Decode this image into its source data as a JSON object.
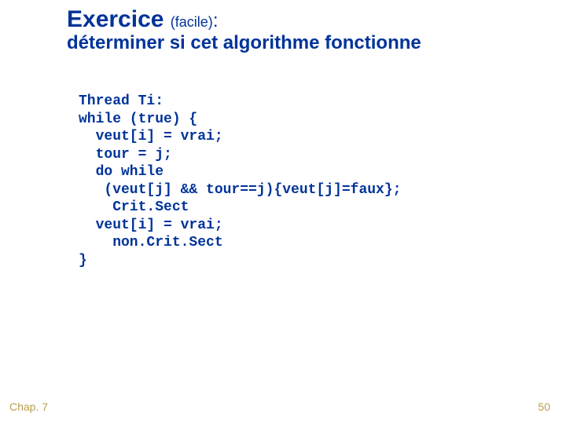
{
  "heading": {
    "title_main": "Exercice",
    "title_paren": "(facile)",
    "title_colon": ":",
    "subtitle": "déterminer si cet algorithme fonctionne"
  },
  "code": {
    "l1": "Thread Ti:",
    "l2": "while (true) {",
    "l3": "  veut[i] = vrai;",
    "l4": "  tour = j;",
    "l5": "  do while",
    "l6": "   (veut[j] && tour==j){veut[j]=faux};",
    "l7": "    Crit.Sect",
    "l8": "  veut[i] = vrai;",
    "l9": "    non.Crit.Sect",
    "l10": "}"
  },
  "footer": {
    "left": "Chap. 7",
    "right": "50"
  }
}
